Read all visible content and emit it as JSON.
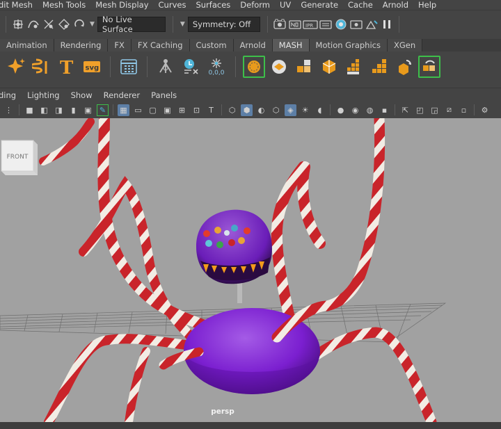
{
  "menubar": {
    "items": [
      "dit Mesh",
      "Mesh Tools",
      "Mesh Display",
      "Curves",
      "Surfaces",
      "Deform",
      "UV",
      "Generate",
      "Cache",
      "Arnold",
      "Help"
    ]
  },
  "statusline": {
    "live_surface": "No Live Surface",
    "symmetry": "Symmetry: Off"
  },
  "shelf_tabs": {
    "items": [
      "Animation",
      "Rendering",
      "FX",
      "FX Caching",
      "Custom",
      "Arnold",
      "MASH",
      "Motion Graphics",
      "XGen"
    ]
  },
  "shelf": {
    "svg_label": "svg",
    "text_label": "T",
    "coords_label": "0,0,0"
  },
  "panel_menu": {
    "items": [
      "ding",
      "Lighting",
      "Show",
      "Renderer",
      "Panels"
    ]
  },
  "viewport": {
    "camera_label": "persp",
    "viewcube_label": "FRONT"
  },
  "colors": {
    "accent_green": "#3dbf4a",
    "viewport_bg": "#a1a1a1",
    "spider_body": "#7b1fd0",
    "candy_red": "#c9242a",
    "candy_white": "#f2ece4"
  }
}
